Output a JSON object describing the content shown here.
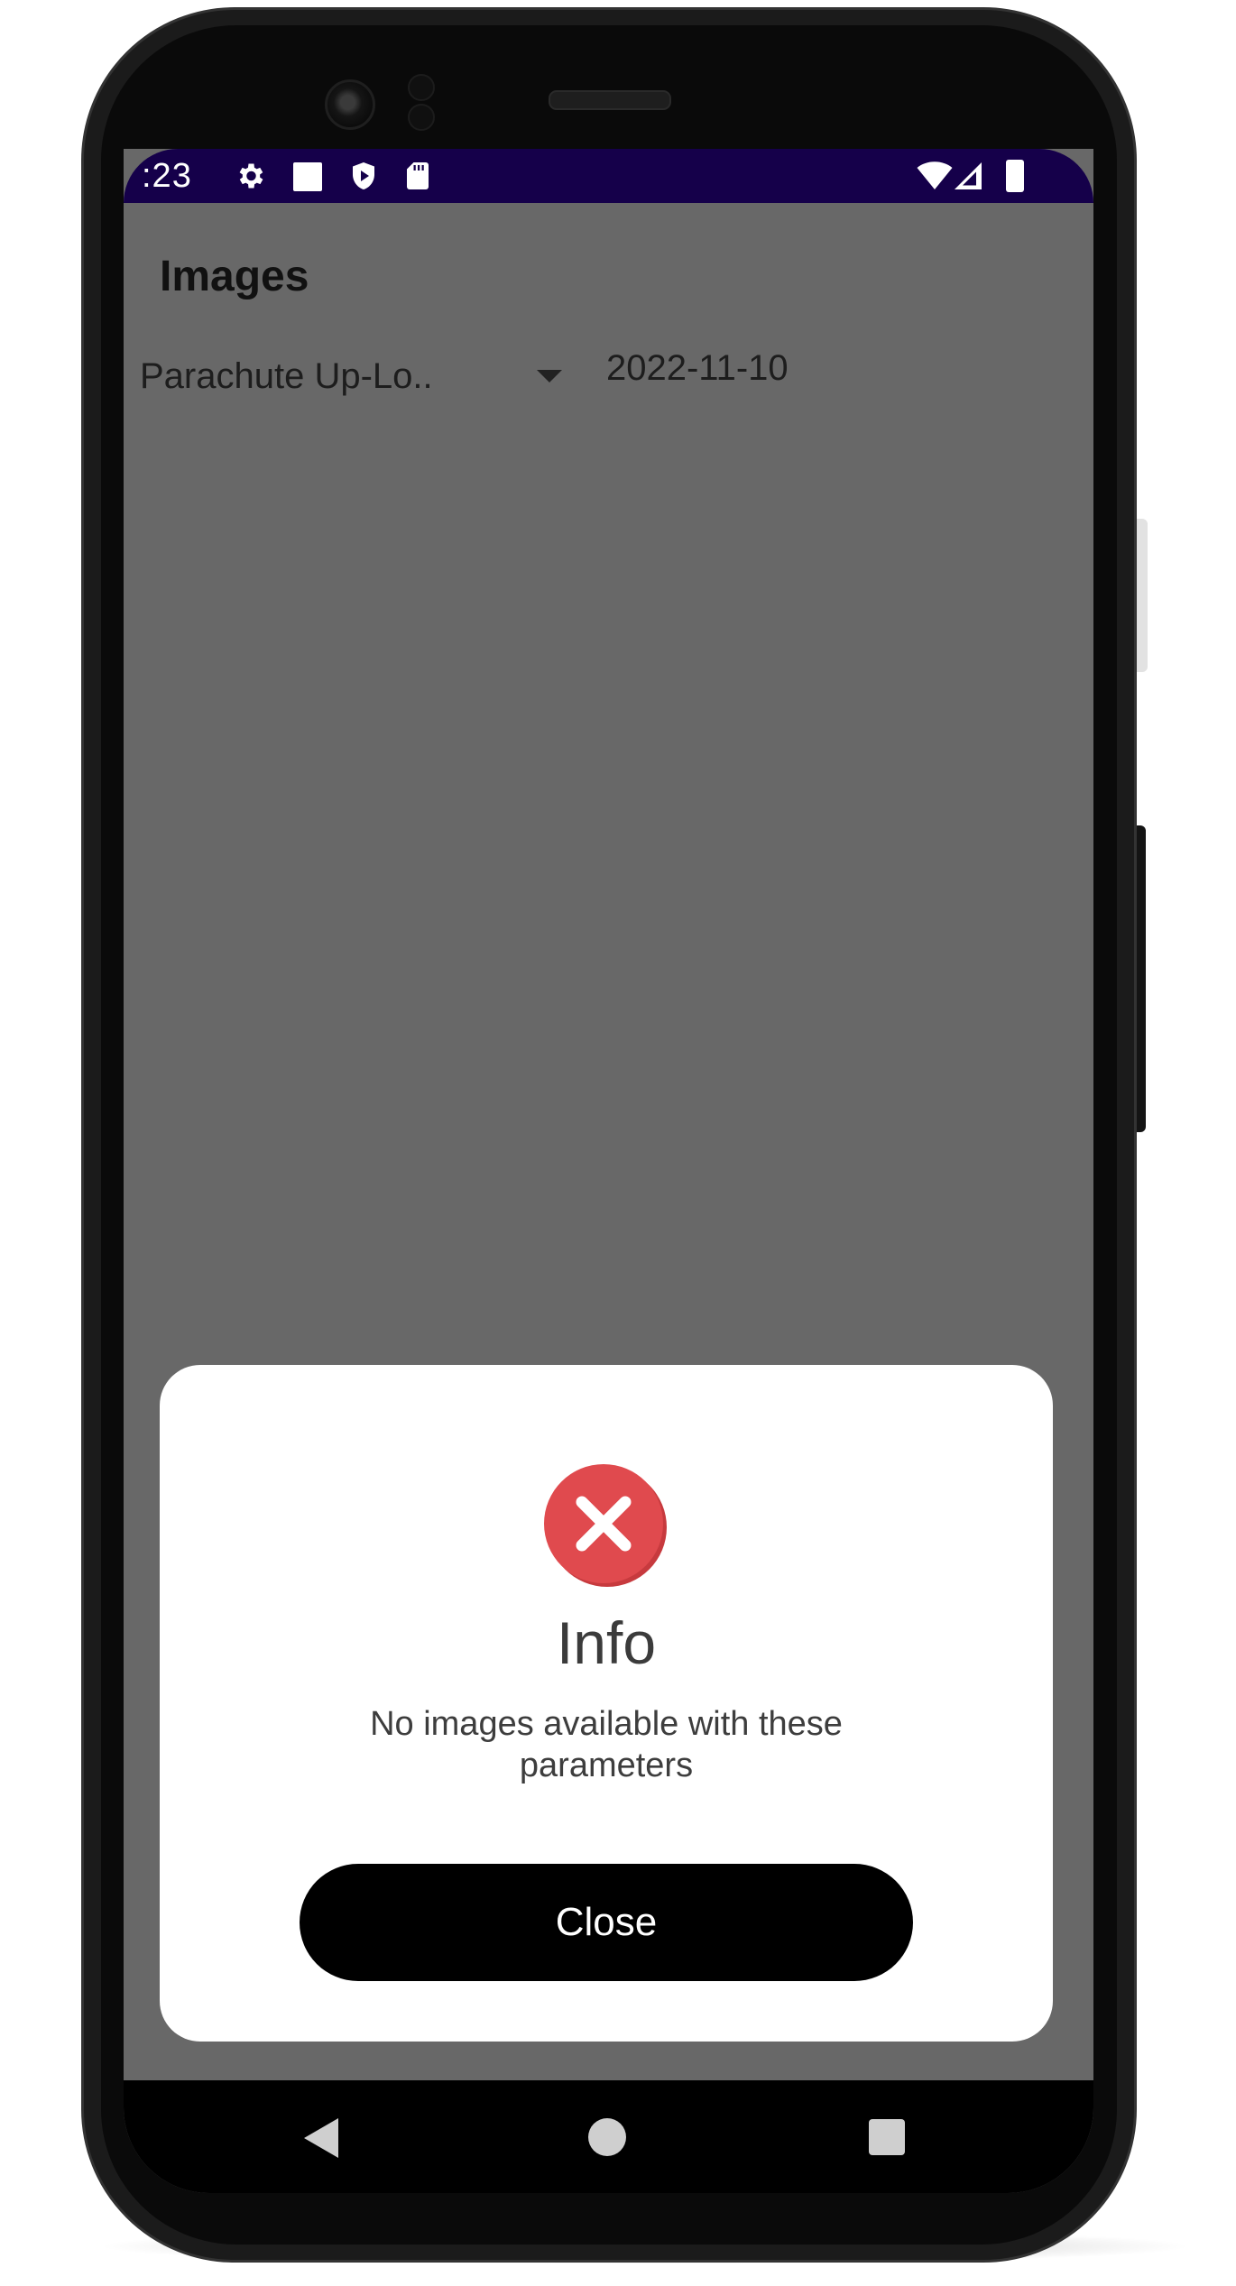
{
  "status_bar": {
    "time": ":23",
    "icons": [
      "gear-icon",
      "square-icon",
      "shield-icon",
      "sdcard-icon",
      "wifi-icon",
      "signal-icon",
      "battery-icon"
    ],
    "background": "#15004a"
  },
  "app": {
    "title": "Images",
    "background": "#686868"
  },
  "filters": {
    "dropdown_value": "Parachute Up-Lo..",
    "date": "2022-11-10"
  },
  "dialog": {
    "icon": "error-x-icon",
    "icon_color": "#e04a4e",
    "title": "Info",
    "message": "No images available with these parameters",
    "close_label": "Close"
  },
  "nav_bar": {
    "buttons": [
      "back-icon",
      "home-icon",
      "recents-icon"
    ]
  }
}
